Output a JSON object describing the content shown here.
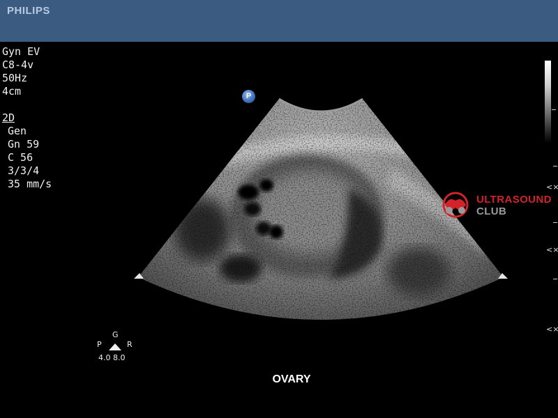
{
  "header": {
    "brand": "PHILIPS"
  },
  "exam_params": {
    "preset": "Gyn EV",
    "transducer": "C8-4v",
    "frame_rate": "50Hz",
    "depth": "4cm",
    "mode": "2D",
    "mode_settings": [
      "Gen",
      "Gn 59",
      "C 56",
      "3/3/4",
      "35 mm/s"
    ]
  },
  "image": {
    "probe_marker": "P",
    "annotation": "OVARY",
    "orientation": {
      "top": "G",
      "left": "P",
      "right": "R",
      "scale": "4.0 8.0"
    }
  },
  "watermark": {
    "line1": "ULTRASOUND",
    "line2": "CLUB",
    "accent_color": "#d2232a"
  },
  "colors": {
    "header_bar": "#3b5b80",
    "background": "#000000"
  }
}
